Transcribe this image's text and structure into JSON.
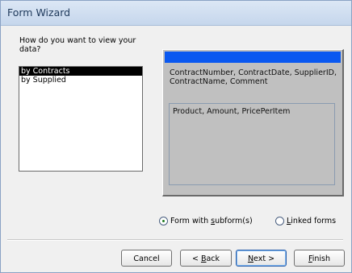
{
  "window": {
    "title": "Form Wizard"
  },
  "prompt": "How do you want to view your data?",
  "view_list": {
    "items": [
      {
        "label": "by Contracts",
        "selected": true
      },
      {
        "label": "by Supplied",
        "selected": false
      }
    ]
  },
  "preview": {
    "header_color": "#0a58f0",
    "main_fields": "ContractNumber, ContractDate, SupplierID, ContractName, Comment",
    "subform_fields": "Product, Amount, PricePerItem"
  },
  "layout_options": {
    "form_with_subforms": {
      "label_pre": "Form with ",
      "label_accel": "s",
      "label_post": "ubform(s)",
      "selected": true
    },
    "linked_forms": {
      "label_pre": "",
      "label_accel": "L",
      "label_post": "inked forms",
      "selected": false
    }
  },
  "buttons": {
    "cancel": "Cancel",
    "back": {
      "prefix": "< ",
      "accel": "B",
      "rest": "ack"
    },
    "next": {
      "prefix": "",
      "accel": "N",
      "rest": "ext >"
    },
    "finish": {
      "prefix": "",
      "accel": "F",
      "rest": "inish"
    }
  }
}
